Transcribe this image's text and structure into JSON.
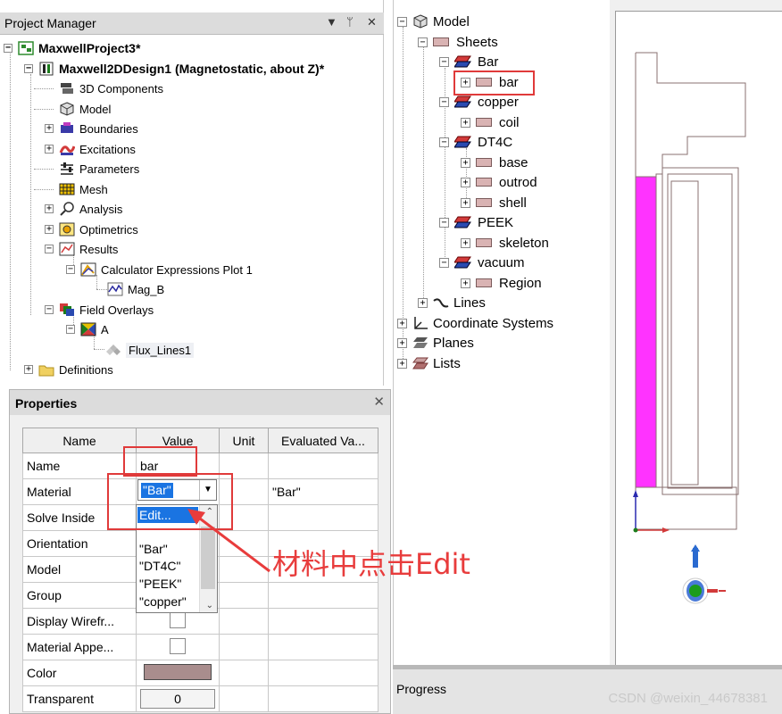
{
  "project_manager": {
    "title": "Project Manager",
    "controls": {
      "dropdown": "▼",
      "pin": "ᛘ",
      "close": "✕"
    },
    "tree": {
      "project": "MaxwellProject3*",
      "design": "Maxwell2DDesign1 (Magnetostatic, about Z)*",
      "items": {
        "components": "3D Components",
        "model": "Model",
        "boundaries": "Boundaries",
        "excitations": "Excitations",
        "parameters": "Parameters",
        "mesh": "Mesh",
        "analysis": "Analysis",
        "optimetrics": "Optimetrics",
        "results": "Results",
        "calc_plot": "Calculator Expressions Plot 1",
        "mag_b": "Mag_B",
        "field_overlays": "Field Overlays",
        "a": "A",
        "flux_lines": "Flux_Lines1",
        "definitions": "Definitions"
      }
    }
  },
  "model_tree": {
    "root": "Model",
    "sheets": "Sheets",
    "materials": [
      {
        "name": "Bar",
        "objects": [
          "bar"
        ]
      },
      {
        "name": "copper",
        "objects": [
          "coil"
        ]
      },
      {
        "name": "DT4C",
        "objects": [
          "base",
          "outrod",
          "shell"
        ]
      },
      {
        "name": "PEEK",
        "objects": [
          "skeleton"
        ]
      },
      {
        "name": "vacuum",
        "objects": [
          "Region"
        ]
      }
    ],
    "lines": "Lines",
    "coordinate_systems": "Coordinate Systems",
    "planes": "Planes",
    "lists": "Lists"
  },
  "properties": {
    "title": "Properties",
    "close": "✕",
    "columns": [
      "Name",
      "Value",
      "Unit",
      "Evaluated Va..."
    ],
    "rows": {
      "name": {
        "label": "Name",
        "value": "bar"
      },
      "material": {
        "label": "Material",
        "value": "\"Bar\"",
        "evaluated": "\"Bar\""
      },
      "solve_inside": {
        "label": "Solve Inside"
      },
      "orientation": {
        "label": "Orientation"
      },
      "model": {
        "label": "Model"
      },
      "group": {
        "label": "Group"
      },
      "display_wireframe": {
        "label": "Display Wirefr..."
      },
      "material_appearance": {
        "label": "Material Appe..."
      },
      "color": {
        "label": "Color",
        "value": "#a98d8d"
      },
      "transparent": {
        "label": "Transparent",
        "value": "0"
      }
    },
    "material_dropdown": {
      "options": [
        "Edit...",
        "\"Bar\"",
        "\"DT4C\"",
        "\"PEEK\"",
        "\"copper\""
      ],
      "highlighted": "Edit..."
    }
  },
  "annotation": "材料中点击Edit",
  "progress": {
    "title": "Progress"
  },
  "watermark": "CSDN @weixin_44678381",
  "colors": {
    "highlight_object": "#ff33ff",
    "annotation": "#e83c3c",
    "selection": "#1a74e2"
  }
}
